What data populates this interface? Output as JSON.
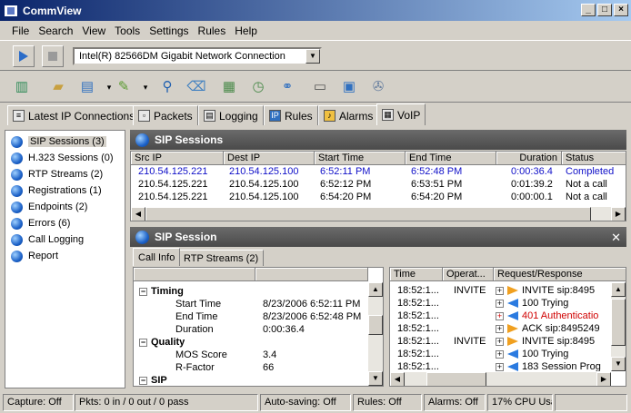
{
  "window": {
    "title": "CommView",
    "min": "_",
    "max": "□",
    "close": "×"
  },
  "menu": [
    "File",
    "Search",
    "View",
    "Tools",
    "Settings",
    "Rules",
    "Help"
  ],
  "adapter": {
    "value": "Intel(R) 82566DM Gigabit Network Connection"
  },
  "tabs": [
    "Latest IP Connections",
    "Packets",
    "Logging",
    "Rules",
    "Alarms",
    "VoIP"
  ],
  "left_items": [
    "SIP Sessions (3)",
    "H.323 Sessions (0)",
    "RTP Streams (2)",
    "Registrations (1)",
    "Endpoints (2)",
    "Errors (6)",
    "Call Logging",
    "Report"
  ],
  "sip_sessions": {
    "title": "SIP Sessions",
    "headers": [
      "Src IP",
      "Dest IP",
      "Start Time",
      "End Time",
      "Duration",
      "Status"
    ],
    "rows": [
      [
        "210.54.125.221",
        "210.54.125.100",
        "6:52:11 PM",
        "6:52:48 PM",
        "0:00:36.4",
        "Completed"
      ],
      [
        "210.54.125.221",
        "210.54.125.100",
        "6:52:12 PM",
        "6:53:51 PM",
        "0:01:39.2",
        "Not a call"
      ],
      [
        "210.54.125.221",
        "210.54.125.100",
        "6:54:20 PM",
        "6:54:20 PM",
        "0:00:00.1",
        "Not a call"
      ]
    ]
  },
  "sip_session": {
    "title": "SIP Session",
    "subtabs": [
      "Call Info",
      "RTP Streams (2)"
    ],
    "tree": [
      {
        "kind": "group",
        "label": "Timing"
      },
      {
        "kind": "item",
        "label": "Start Time",
        "value": "8/23/2006 6:52:11 PM"
      },
      {
        "kind": "item",
        "label": "End Time",
        "value": "8/23/2006 6:52:48 PM"
      },
      {
        "kind": "item",
        "label": "Duration",
        "value": "0:00:36.4"
      },
      {
        "kind": "group",
        "label": "Quality"
      },
      {
        "kind": "item",
        "label": "MOS Score",
        "value": "3.4"
      },
      {
        "kind": "item",
        "label": "R-Factor",
        "value": "66"
      },
      {
        "kind": "group",
        "label": "SIP"
      }
    ],
    "msg_headers": [
      "Time",
      "Operat...",
      "Request/Response"
    ],
    "messages": [
      {
        "time": "18:52:1...",
        "op": "INVITE",
        "dir": "out",
        "text": "INVITE sip:8495",
        "color": "black"
      },
      {
        "time": "18:52:1...",
        "op": "",
        "dir": "in",
        "text": "100 Trying",
        "color": "black"
      },
      {
        "time": "18:52:1...",
        "op": "",
        "dir": "in",
        "text": "401 Authenticatio",
        "color": "red"
      },
      {
        "time": "18:52:1...",
        "op": "",
        "dir": "out",
        "text": "ACK sip:8495249",
        "color": "black"
      },
      {
        "time": "18:52:1...",
        "op": "INVITE",
        "dir": "out",
        "text": "INVITE sip:8495",
        "color": "black"
      },
      {
        "time": "18:52:1...",
        "op": "",
        "dir": "in",
        "text": "100 Trying",
        "color": "black"
      },
      {
        "time": "18:52:1...",
        "op": "",
        "dir": "in",
        "text": "183 Session Prog",
        "color": "black"
      }
    ]
  },
  "status": [
    "Capture: Off",
    "Pkts: 0 in / 0 out / 0 pass",
    "Auto-saving: Off",
    "Rules: Off",
    "Alarms: Off",
    "17% CPU Usa"
  ]
}
